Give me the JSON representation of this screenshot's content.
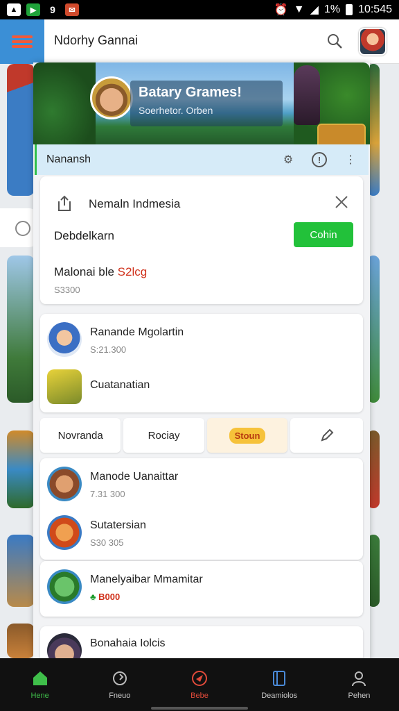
{
  "status_bar": {
    "icons": [
      "image-icon",
      "play-icon",
      "nine-icon",
      "mail-icon"
    ],
    "battery": "1%",
    "time": "10:545"
  },
  "header": {
    "title": "Ndorhy Gannai"
  },
  "banner": {
    "title": "Batary Grames!",
    "subtitle": "Soerhetor. Orben"
  },
  "toolbar": {
    "title": "Nanansh"
  },
  "notice_card": {
    "title": "Nemaln Indmesia",
    "row_label": "Debdelkarn",
    "cta_label": "Cohin",
    "row2_label": "Malonai ble ",
    "row2_highlight": "S2lcg",
    "row2_sub": "S3300"
  },
  "list_a": [
    {
      "title": "Ranande Mgolartin",
      "sub": "S:21.300"
    },
    {
      "title": "Cuatanatian",
      "sub": ""
    }
  ],
  "tabs": {
    "labels": [
      "Novranda",
      "Rociay",
      "Stoun"
    ]
  },
  "list_b": [
    {
      "title": "Manode Uanaittar",
      "sub": "7.31 300"
    },
    {
      "title": "Sutatersian",
      "sub": "S30 305"
    }
  ],
  "list_c": {
    "title": "Manelyaibar Mmamitar",
    "sub": "B000"
  },
  "list_d": {
    "title": "Bonahaia Iolcis"
  },
  "bottom_nav": [
    {
      "label": "Hene",
      "icon": "home-icon"
    },
    {
      "label": "Fneuo",
      "icon": "refresh-icon"
    },
    {
      "label": "Bebe",
      "icon": "send-icon"
    },
    {
      "label": "Deamiolos",
      "icon": "book-icon"
    },
    {
      "label": "Pehen",
      "icon": "person-icon"
    }
  ],
  "colors": {
    "accent_blue": "#3b8fd6",
    "cta_green": "#22c13a",
    "toolbar_bg": "#d6ebf8",
    "highlight_red": "#d0301a"
  }
}
